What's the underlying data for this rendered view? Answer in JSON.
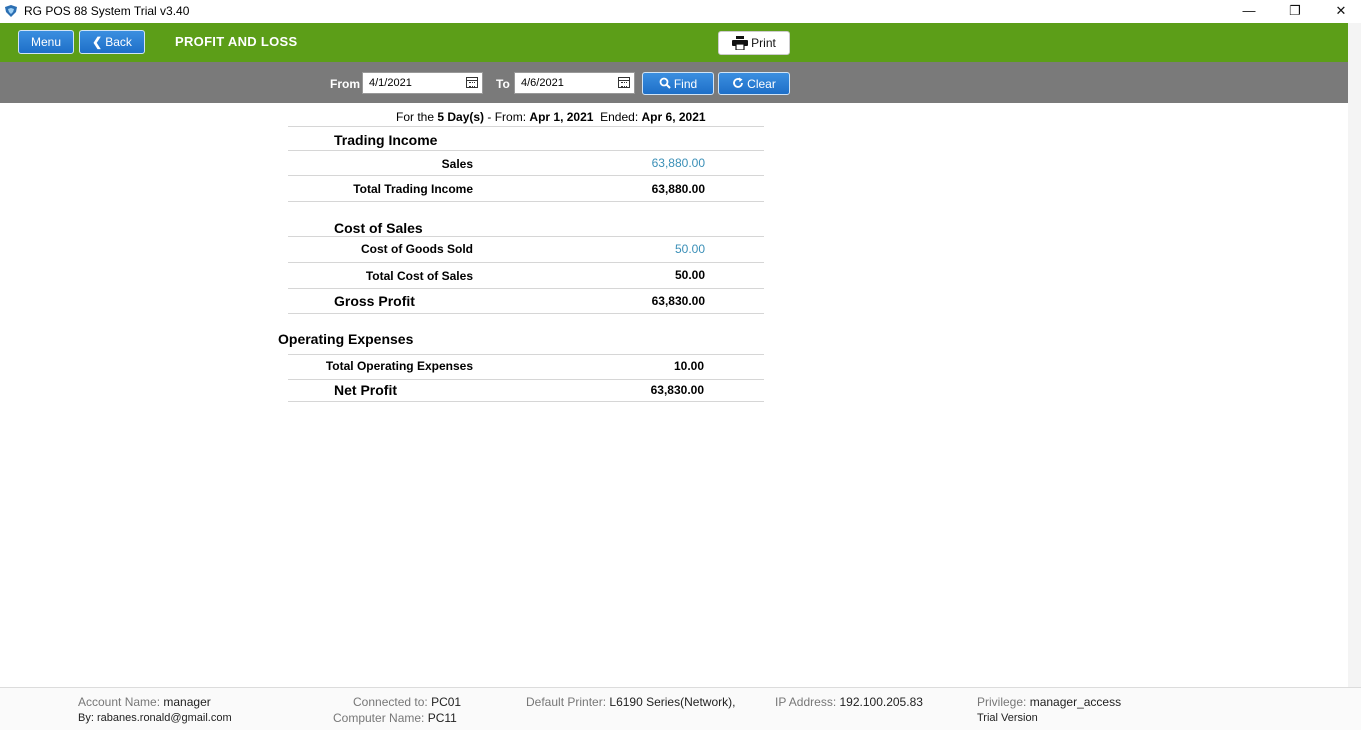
{
  "window": {
    "title": "RG POS 88 System Trial v3.40",
    "minimize": "—",
    "maximize": "❐",
    "close": "✕"
  },
  "header": {
    "menu_label": "Menu",
    "back_label": "Back",
    "title": "PROFIT AND LOSS",
    "print_label": "Print"
  },
  "filter": {
    "from_label": "From",
    "from_value": "4/1/2021",
    "to_label": "To",
    "to_value": "4/6/2021",
    "find_label": "Find",
    "clear_label": "Clear"
  },
  "report": {
    "period_prefix": "For the",
    "period_days": "5 Day(s)",
    "period_from_label": "- From:",
    "period_from": "Apr 1, 2021",
    "period_end_label": "Ended:",
    "period_end": "Apr 6, 2021",
    "trading_income": {
      "heading": "Trading Income",
      "sales_label": "Sales",
      "sales_value": "63,880.00",
      "total_label": "Total Trading Income",
      "total_value": "63,880.00"
    },
    "cost_of_sales": {
      "heading": "Cost of Sales",
      "cogs_label": "Cost of Goods Sold",
      "cogs_value": "50.00",
      "total_label": "Total Cost of Sales",
      "total_value": "50.00"
    },
    "gross_profit": {
      "label": "Gross Profit",
      "value": "63,830.00"
    },
    "operating_expenses": {
      "heading": "Operating Expenses",
      "total_label": "Total Operating Expenses",
      "total_value": "10.00"
    },
    "net_profit": {
      "label": "Net Profit",
      "value": "63,830.00"
    }
  },
  "status": {
    "account_label": "Account Name:",
    "account_value": "manager",
    "by_label": "By:",
    "by_value": "rabanes.ronald@gmail.com",
    "connected_label": "Connected to:",
    "connected_value": "PC01",
    "computer_label": "Computer Name:",
    "computer_value": "PC11",
    "printer_label": "Default Printer:",
    "printer_value": "L6190 Series(Network),",
    "ip_label": "IP Address:",
    "ip_value": "192.100.205.83",
    "privilege_label": "Privilege:",
    "privilege_value": "manager_access",
    "version": "Trial Version"
  },
  "colors": {
    "header_green": "#5c9e18",
    "filter_gray": "#7a7a7a",
    "button_blue": "#1e6fc8",
    "link_blue": "#3a8fb7"
  }
}
